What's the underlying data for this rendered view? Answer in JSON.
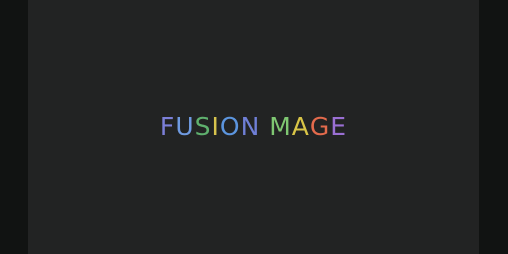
{
  "title": {
    "text": "FUSION MAGE",
    "letters": [
      {
        "char": "F",
        "color": "#7c7fd8"
      },
      {
        "char": "U",
        "color": "#6f9ae0"
      },
      {
        "char": "S",
        "color": "#5fb06e"
      },
      {
        "char": "I",
        "color": "#d7c34d"
      },
      {
        "char": "O",
        "color": "#5c95de"
      },
      {
        "char": "N",
        "color": "#6f7fd6"
      },
      {
        "char": " ",
        "color": "#222323"
      },
      {
        "char": "M",
        "color": "#7fc772"
      },
      {
        "char": "A",
        "color": "#d9c547"
      },
      {
        "char": "G",
        "color": "#e36a4c"
      },
      {
        "char": "E",
        "color": "#9a6fd3"
      }
    ]
  },
  "colors": {
    "background": "#222323",
    "letterbox": "#111312"
  }
}
